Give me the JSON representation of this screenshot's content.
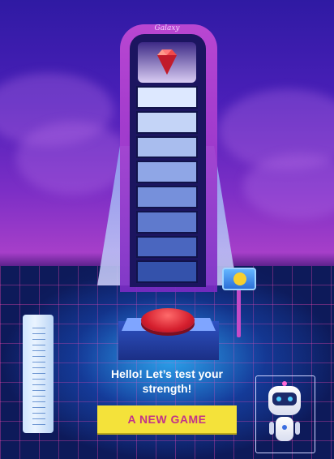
{
  "tower": {
    "brand": "Galaxy"
  },
  "meter": {
    "segments": 8,
    "colors": [
      "#dde8ff",
      "#c4d4f7",
      "#a9bdee",
      "#8fa6e6",
      "#7690db",
      "#5f7acd",
      "#4a66bf",
      "#3452ab"
    ]
  },
  "message": {
    "line1": "Hello! Let’s test your",
    "line2": "strength!"
  },
  "actions": {
    "new_game_label": "A NEW GAME"
  },
  "colors": {
    "accent_yellow": "#f4e23a",
    "accent_pink": "#c1338a",
    "sky_top": "#2f1aa3",
    "hit_button": "#d51f2e"
  }
}
